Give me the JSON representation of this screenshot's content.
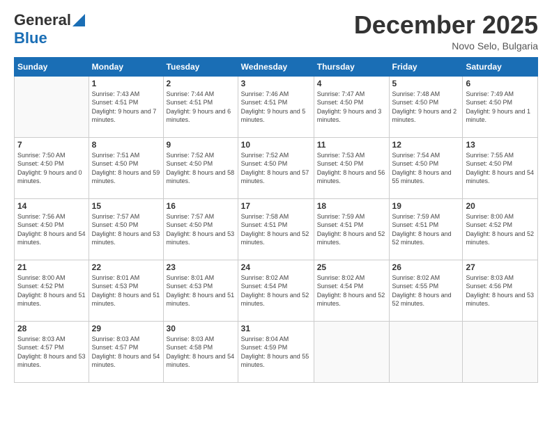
{
  "logo": {
    "general": "General",
    "blue": "Blue"
  },
  "title": "December 2025",
  "location": "Novo Selo, Bulgaria",
  "weekdays": [
    "Sunday",
    "Monday",
    "Tuesday",
    "Wednesday",
    "Thursday",
    "Friday",
    "Saturday"
  ],
  "days": [
    {
      "num": "",
      "sunrise": "",
      "sunset": "",
      "daylight": ""
    },
    {
      "num": "1",
      "sunrise": "Sunrise: 7:43 AM",
      "sunset": "Sunset: 4:51 PM",
      "daylight": "Daylight: 9 hours and 7 minutes."
    },
    {
      "num": "2",
      "sunrise": "Sunrise: 7:44 AM",
      "sunset": "Sunset: 4:51 PM",
      "daylight": "Daylight: 9 hours and 6 minutes."
    },
    {
      "num": "3",
      "sunrise": "Sunrise: 7:46 AM",
      "sunset": "Sunset: 4:51 PM",
      "daylight": "Daylight: 9 hours and 5 minutes."
    },
    {
      "num": "4",
      "sunrise": "Sunrise: 7:47 AM",
      "sunset": "Sunset: 4:50 PM",
      "daylight": "Daylight: 9 hours and 3 minutes."
    },
    {
      "num": "5",
      "sunrise": "Sunrise: 7:48 AM",
      "sunset": "Sunset: 4:50 PM",
      "daylight": "Daylight: 9 hours and 2 minutes."
    },
    {
      "num": "6",
      "sunrise": "Sunrise: 7:49 AM",
      "sunset": "Sunset: 4:50 PM",
      "daylight": "Daylight: 9 hours and 1 minute."
    },
    {
      "num": "7",
      "sunrise": "Sunrise: 7:50 AM",
      "sunset": "Sunset: 4:50 PM",
      "daylight": "Daylight: 9 hours and 0 minutes."
    },
    {
      "num": "8",
      "sunrise": "Sunrise: 7:51 AM",
      "sunset": "Sunset: 4:50 PM",
      "daylight": "Daylight: 8 hours and 59 minutes."
    },
    {
      "num": "9",
      "sunrise": "Sunrise: 7:52 AM",
      "sunset": "Sunset: 4:50 PM",
      "daylight": "Daylight: 8 hours and 58 minutes."
    },
    {
      "num": "10",
      "sunrise": "Sunrise: 7:52 AM",
      "sunset": "Sunset: 4:50 PM",
      "daylight": "Daylight: 8 hours and 57 minutes."
    },
    {
      "num": "11",
      "sunrise": "Sunrise: 7:53 AM",
      "sunset": "Sunset: 4:50 PM",
      "daylight": "Daylight: 8 hours and 56 minutes."
    },
    {
      "num": "12",
      "sunrise": "Sunrise: 7:54 AM",
      "sunset": "Sunset: 4:50 PM",
      "daylight": "Daylight: 8 hours and 55 minutes."
    },
    {
      "num": "13",
      "sunrise": "Sunrise: 7:55 AM",
      "sunset": "Sunset: 4:50 PM",
      "daylight": "Daylight: 8 hours and 54 minutes."
    },
    {
      "num": "14",
      "sunrise": "Sunrise: 7:56 AM",
      "sunset": "Sunset: 4:50 PM",
      "daylight": "Daylight: 8 hours and 54 minutes."
    },
    {
      "num": "15",
      "sunrise": "Sunrise: 7:57 AM",
      "sunset": "Sunset: 4:50 PM",
      "daylight": "Daylight: 8 hours and 53 minutes."
    },
    {
      "num": "16",
      "sunrise": "Sunrise: 7:57 AM",
      "sunset": "Sunset: 4:50 PM",
      "daylight": "Daylight: 8 hours and 53 minutes."
    },
    {
      "num": "17",
      "sunrise": "Sunrise: 7:58 AM",
      "sunset": "Sunset: 4:51 PM",
      "daylight": "Daylight: 8 hours and 52 minutes."
    },
    {
      "num": "18",
      "sunrise": "Sunrise: 7:59 AM",
      "sunset": "Sunset: 4:51 PM",
      "daylight": "Daylight: 8 hours and 52 minutes."
    },
    {
      "num": "19",
      "sunrise": "Sunrise: 7:59 AM",
      "sunset": "Sunset: 4:51 PM",
      "daylight": "Daylight: 8 hours and 52 minutes."
    },
    {
      "num": "20",
      "sunrise": "Sunrise: 8:00 AM",
      "sunset": "Sunset: 4:52 PM",
      "daylight": "Daylight: 8 hours and 52 minutes."
    },
    {
      "num": "21",
      "sunrise": "Sunrise: 8:00 AM",
      "sunset": "Sunset: 4:52 PM",
      "daylight": "Daylight: 8 hours and 51 minutes."
    },
    {
      "num": "22",
      "sunrise": "Sunrise: 8:01 AM",
      "sunset": "Sunset: 4:53 PM",
      "daylight": "Daylight: 8 hours and 51 minutes."
    },
    {
      "num": "23",
      "sunrise": "Sunrise: 8:01 AM",
      "sunset": "Sunset: 4:53 PM",
      "daylight": "Daylight: 8 hours and 51 minutes."
    },
    {
      "num": "24",
      "sunrise": "Sunrise: 8:02 AM",
      "sunset": "Sunset: 4:54 PM",
      "daylight": "Daylight: 8 hours and 52 minutes."
    },
    {
      "num": "25",
      "sunrise": "Sunrise: 8:02 AM",
      "sunset": "Sunset: 4:54 PM",
      "daylight": "Daylight: 8 hours and 52 minutes."
    },
    {
      "num": "26",
      "sunrise": "Sunrise: 8:02 AM",
      "sunset": "Sunset: 4:55 PM",
      "daylight": "Daylight: 8 hours and 52 minutes."
    },
    {
      "num": "27",
      "sunrise": "Sunrise: 8:03 AM",
      "sunset": "Sunset: 4:56 PM",
      "daylight": "Daylight: 8 hours and 53 minutes."
    },
    {
      "num": "28",
      "sunrise": "Sunrise: 8:03 AM",
      "sunset": "Sunset: 4:57 PM",
      "daylight": "Daylight: 8 hours and 53 minutes."
    },
    {
      "num": "29",
      "sunrise": "Sunrise: 8:03 AM",
      "sunset": "Sunset: 4:57 PM",
      "daylight": "Daylight: 8 hours and 54 minutes."
    },
    {
      "num": "30",
      "sunrise": "Sunrise: 8:03 AM",
      "sunset": "Sunset: 4:58 PM",
      "daylight": "Daylight: 8 hours and 54 minutes."
    },
    {
      "num": "31",
      "sunrise": "Sunrise: 8:04 AM",
      "sunset": "Sunset: 4:59 PM",
      "daylight": "Daylight: 8 hours and 55 minutes."
    }
  ]
}
